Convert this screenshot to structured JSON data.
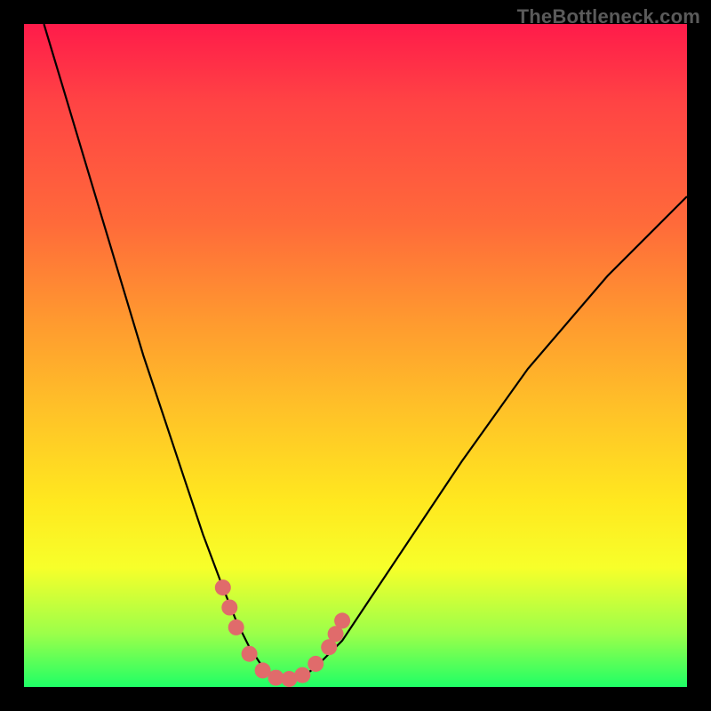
{
  "watermark": "TheBottleneck.com",
  "chart_data": {
    "type": "line",
    "title": "",
    "xlabel": "",
    "ylabel": "",
    "xlim": [
      0,
      100
    ],
    "ylim": [
      0,
      100
    ],
    "series": [
      {
        "name": "bottleneck-curve",
        "x": [
          3,
          6,
          9,
          12,
          15,
          18,
          21,
          24,
          27,
          30,
          32,
          34,
          36,
          38,
          40,
          42,
          44,
          48,
          52,
          58,
          66,
          76,
          88,
          100
        ],
        "y": [
          100,
          90,
          80,
          70,
          60,
          50,
          41,
          32,
          23,
          15,
          10,
          6,
          3,
          1.5,
          1,
          1.5,
          3,
          7,
          13,
          22,
          34,
          48,
          62,
          74
        ]
      }
    ],
    "highlight": {
      "name": "bottom-dots",
      "color": "#e06b6b",
      "points": [
        {
          "x": 30,
          "y": 15
        },
        {
          "x": 31,
          "y": 12
        },
        {
          "x": 32,
          "y": 9
        },
        {
          "x": 34,
          "y": 5
        },
        {
          "x": 36,
          "y": 2.5
        },
        {
          "x": 38,
          "y": 1.4
        },
        {
          "x": 40,
          "y": 1.2
        },
        {
          "x": 42,
          "y": 1.8
        },
        {
          "x": 44,
          "y": 3.5
        },
        {
          "x": 46,
          "y": 6
        },
        {
          "x": 47,
          "y": 8
        },
        {
          "x": 48,
          "y": 10
        }
      ]
    }
  }
}
